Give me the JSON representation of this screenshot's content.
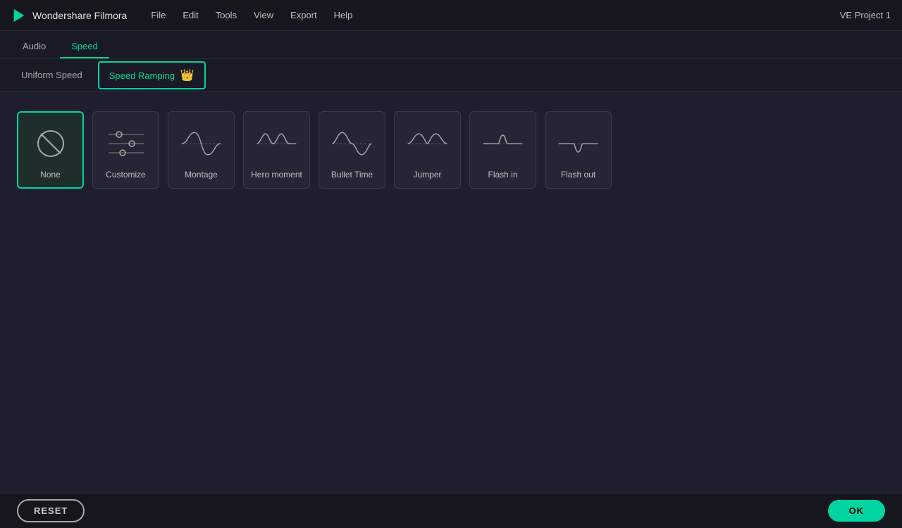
{
  "app": {
    "logo_text": "Wondershare Filmora",
    "project_name": "VE Project 1"
  },
  "menu": {
    "items": [
      "File",
      "Edit",
      "Tools",
      "View",
      "Export",
      "Help"
    ]
  },
  "tabs": {
    "items": [
      {
        "label": "Audio",
        "active": false
      },
      {
        "label": "Speed",
        "active": true
      }
    ]
  },
  "subtabs": {
    "items": [
      {
        "label": "Uniform Speed",
        "active": false
      },
      {
        "label": "Speed Ramping",
        "active": true,
        "has_crown": true
      }
    ]
  },
  "speed_cards": [
    {
      "id": "none",
      "label": "None",
      "selected": true,
      "type": "none"
    },
    {
      "id": "customize",
      "label": "Customize",
      "selected": false,
      "type": "customize"
    },
    {
      "id": "montage",
      "label": "Montage",
      "selected": false,
      "type": "montage"
    },
    {
      "id": "hero-moment",
      "label": "Hero moment",
      "selected": false,
      "type": "hero_moment"
    },
    {
      "id": "bullet-time",
      "label": "Bullet Time",
      "selected": false,
      "type": "bullet_time"
    },
    {
      "id": "jumper",
      "label": "Jumper",
      "selected": false,
      "type": "jumper"
    },
    {
      "id": "flash-in",
      "label": "Flash in",
      "selected": false,
      "type": "flash_in"
    },
    {
      "id": "flash-out",
      "label": "Flash out",
      "selected": false,
      "type": "flash_out"
    }
  ],
  "buttons": {
    "reset_label": "RESET",
    "ok_label": "OK"
  },
  "colors": {
    "accent": "#00d4a0",
    "border_active": "#00d4a0"
  }
}
